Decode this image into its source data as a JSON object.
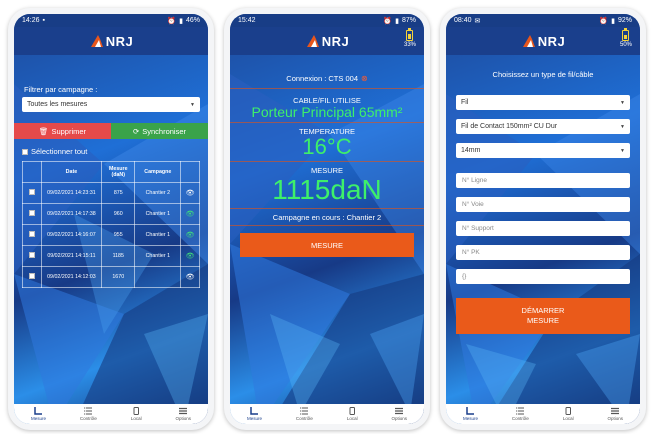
{
  "status_bars": [
    {
      "time": "14:26",
      "right": "46%"
    },
    {
      "time": "15:42",
      "right": "87%"
    },
    {
      "time": "08:40",
      "right": "92%"
    }
  ],
  "logo_text": "NRJ",
  "battery": {
    "screen2": "33%",
    "screen3": "50%"
  },
  "tabs": [
    "Mesure",
    "Contrôle",
    "Local",
    "Options"
  ],
  "screen1": {
    "filter_label": "Filtrer par campagne :",
    "filter_value": "Toutes les mesures",
    "delete_label": "Supprimer",
    "sync_label": "Synchroniser",
    "select_all": "Sélectionner tout",
    "columns": [
      "Date",
      "Mesure (daN)",
      "Campagne"
    ],
    "rows": [
      {
        "date": "09/02/2021 14:23:31",
        "mesure": "875",
        "campagne": "Chantier 2"
      },
      {
        "date": "09/02/2021 14:17:38",
        "mesure": "960",
        "campagne": "Chantier 1"
      },
      {
        "date": "09/02/2021 14:16:07",
        "mesure": "955",
        "campagne": "Chantier 1"
      },
      {
        "date": "09/02/2021 14:15:11",
        "mesure": "1185",
        "campagne": "Chantier 1"
      },
      {
        "date": "09/02/2021 14:12:03",
        "mesure": "1670",
        "campagne": ""
      }
    ]
  },
  "screen2": {
    "connection": "Connexion : CTS 004",
    "cable_label": "CABLE/FIL UTILISE",
    "cable_value": "Porteur Principal 65mm²",
    "temp_label": "TEMPERATURE",
    "temp_value": "16°C",
    "mesure_label": "MESURE",
    "mesure_value": "1115daN",
    "campaign": "Campagne en cours : Chantier 2",
    "button": "MESURE"
  },
  "screen3": {
    "title": "Choisissez un type de fil/câble",
    "select1": "Fil",
    "select2": "Fil de Contact 150mm² CU Dur",
    "select3": "14mm",
    "ph_ligne": "N° Ligne",
    "ph_voie": "N° Voie",
    "ph_support": "N° Support",
    "ph_pk": "N° PK",
    "ph_empty": "{}",
    "button_line1": "DÉMARRER",
    "button_line2": "MESURE"
  }
}
